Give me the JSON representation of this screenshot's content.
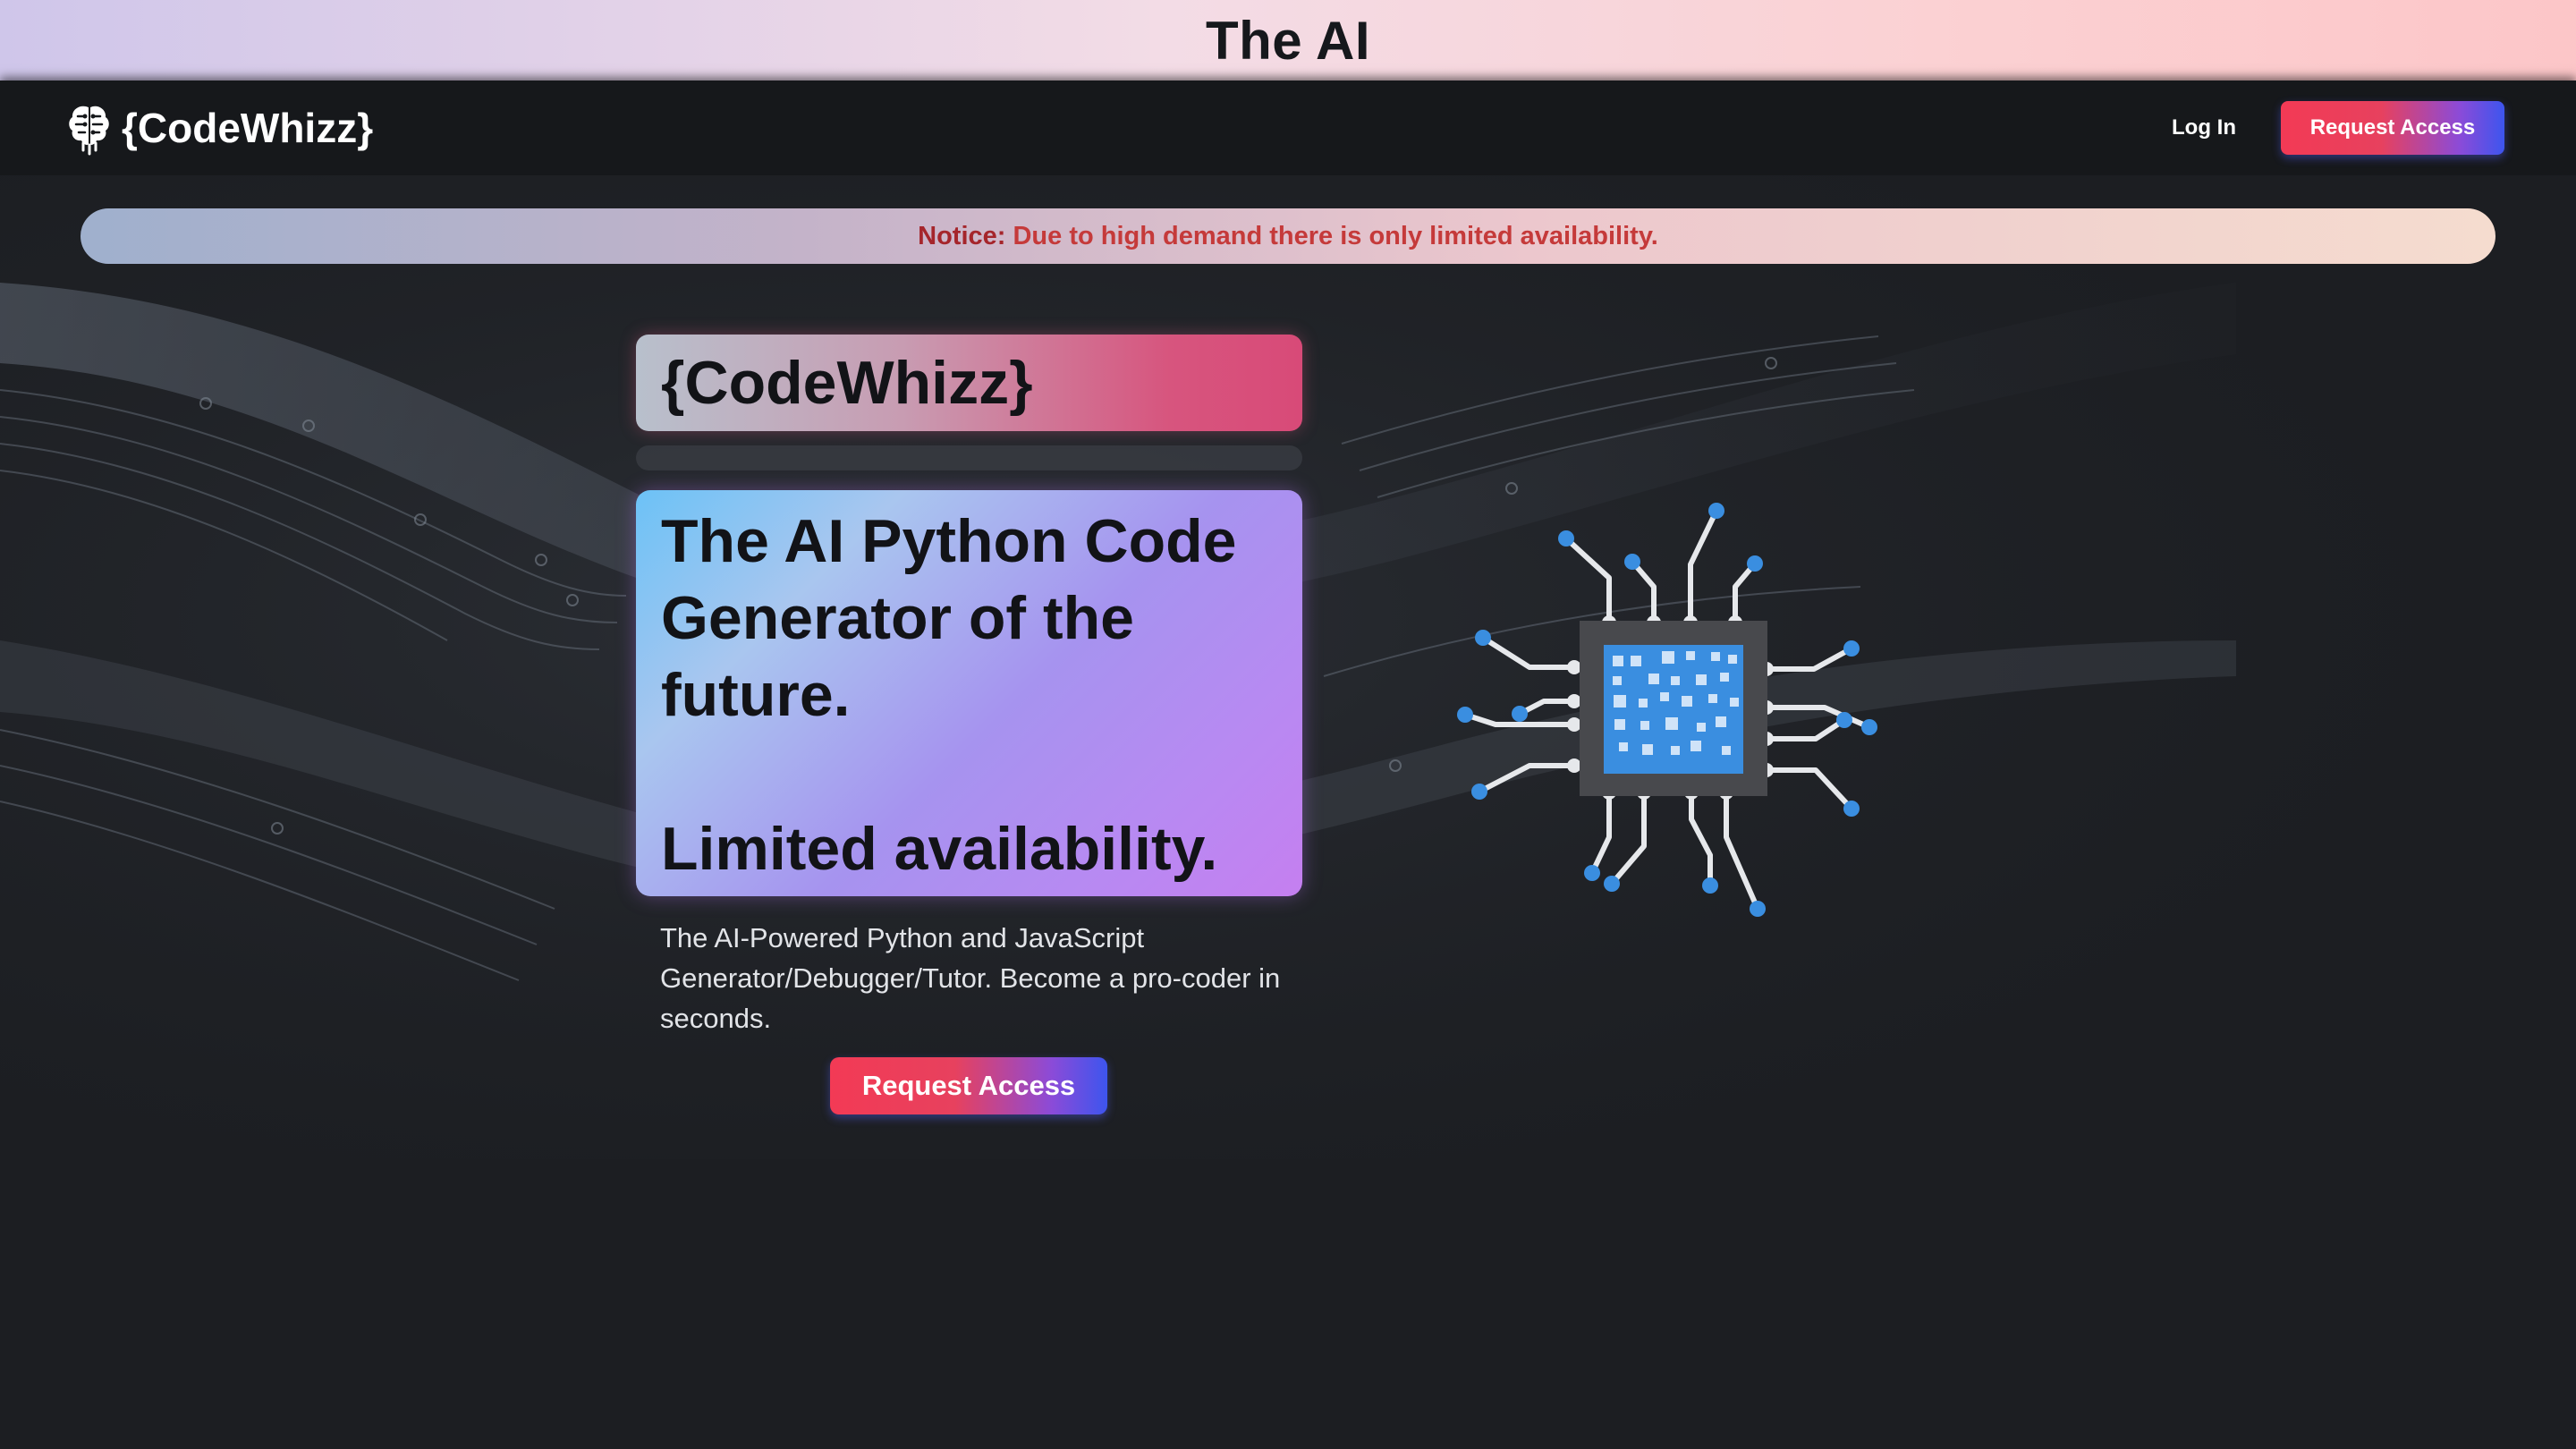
{
  "top_strip": {
    "title": "The AI"
  },
  "navbar": {
    "brand": "{CodeWhizz}",
    "brand_icon": "brain-icon",
    "login_label": "Log In",
    "request_label": "Request Access"
  },
  "notice": {
    "label": "Notice:",
    "message": "Due to high demand there is only limited availability."
  },
  "hero": {
    "product_title": "{CodeWhizz}",
    "headline": "The AI Python Code Generator of the future.",
    "subheadline": "Limited availability.",
    "description": "The AI-Powered Python and JavaScript Generator/Debugger/Tutor. Become a pro-coder in seconds.",
    "cta_label": "Request Access",
    "illustration_icon": "cpu-chip-icon"
  },
  "colors": {
    "accent_red": "#f33a55",
    "accent_blue": "#3d55ee",
    "notice_text": "#c53a3a",
    "chip_blue": "#3a8ee0",
    "background": "#1c1e22"
  }
}
